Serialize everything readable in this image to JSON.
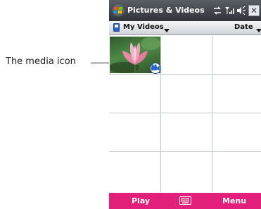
{
  "annotation": {
    "text": "The media icon"
  },
  "window": {
    "title": "Pictures & Videos",
    "close_label": "✕"
  },
  "toolbar": {
    "folder_label": "My Videos",
    "sort_label": "Date"
  },
  "grid": {
    "columns": 3,
    "rows": 4,
    "items": [
      {
        "type": "video-thumbnail",
        "icon": "media-icon"
      }
    ]
  },
  "softkeys": {
    "left": "Play",
    "center_icon": "keyboard-icon",
    "right": "Menu"
  },
  "colors": {
    "titlebar": "#3a3f47",
    "softkey_bar": "#e21f7a",
    "grid_lines": "#c4c8cd",
    "folder_icon": "#2a66c8"
  }
}
